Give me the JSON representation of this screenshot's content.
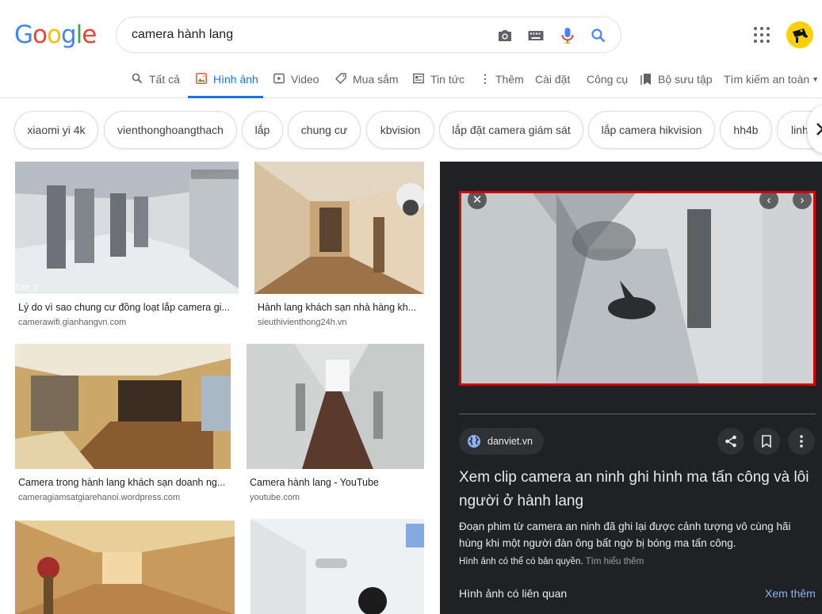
{
  "logo": [
    "G",
    "o",
    "o",
    "g",
    "l",
    "e"
  ],
  "logo_colors": [
    "#4285f4",
    "#ea4335",
    "#fbbc05",
    "#4285f4",
    "#34a853",
    "#ea4335"
  ],
  "search": {
    "query": "camera hành lang"
  },
  "tabs": {
    "all": "Tất cả",
    "images": "Hình ảnh",
    "videos": "Video",
    "shopping": "Mua sắm",
    "news": "Tin tức",
    "more": "Thêm",
    "settings": "Cài đặt",
    "tools": "Công cụ",
    "collections": "Bộ sưu tập",
    "safesearch": "Tìm kiếm an toàn"
  },
  "chips": [
    "xiaomi yi 4k",
    "vienthonghoangthach",
    "lắp",
    "chung cư",
    "kbvision",
    "lắp đặt camera giám sát",
    "lắp camera hikvision",
    "hh4b",
    "linh"
  ],
  "results": [
    {
      "title": "Lý do vì sao chung cư đồng loạt lắp camera gi...",
      "site": "camerawifi.gianhangvn.com",
      "overlay": "CAM 3"
    },
    {
      "title": "Hành lang khách sạn nhà hàng kh...",
      "site": "sieuthivienthong24h.vn"
    },
    {
      "title": "Camera trong hành lang khách sạn doanh ng...",
      "site": "cameragiamsatgiarehanoi.wordpress.com"
    },
    {
      "title": "Camera hành lang - YouTube",
      "site": "youtube.com"
    }
  ],
  "panel": {
    "site": "danviet.vn",
    "title": "Xem clip camera an ninh ghi hình ma tấn công và lôi người ở hành lang",
    "description": "Đoạn phim từ camera an ninh đã ghi lại được cảnh tượng vô cùng hãi hùng khi một người đàn ông bất ngờ bị bóng ma tấn công.",
    "copyright": "Hình ảnh có thể có bản quyền.",
    "learn_more": "Tìm hiểu thêm",
    "related": "Hình ảnh có liên quan",
    "see_more": "Xem thêm"
  },
  "colors": {
    "accent": "#1a73e8",
    "panel_bg": "#202124",
    "highlight": "#d20000"
  }
}
